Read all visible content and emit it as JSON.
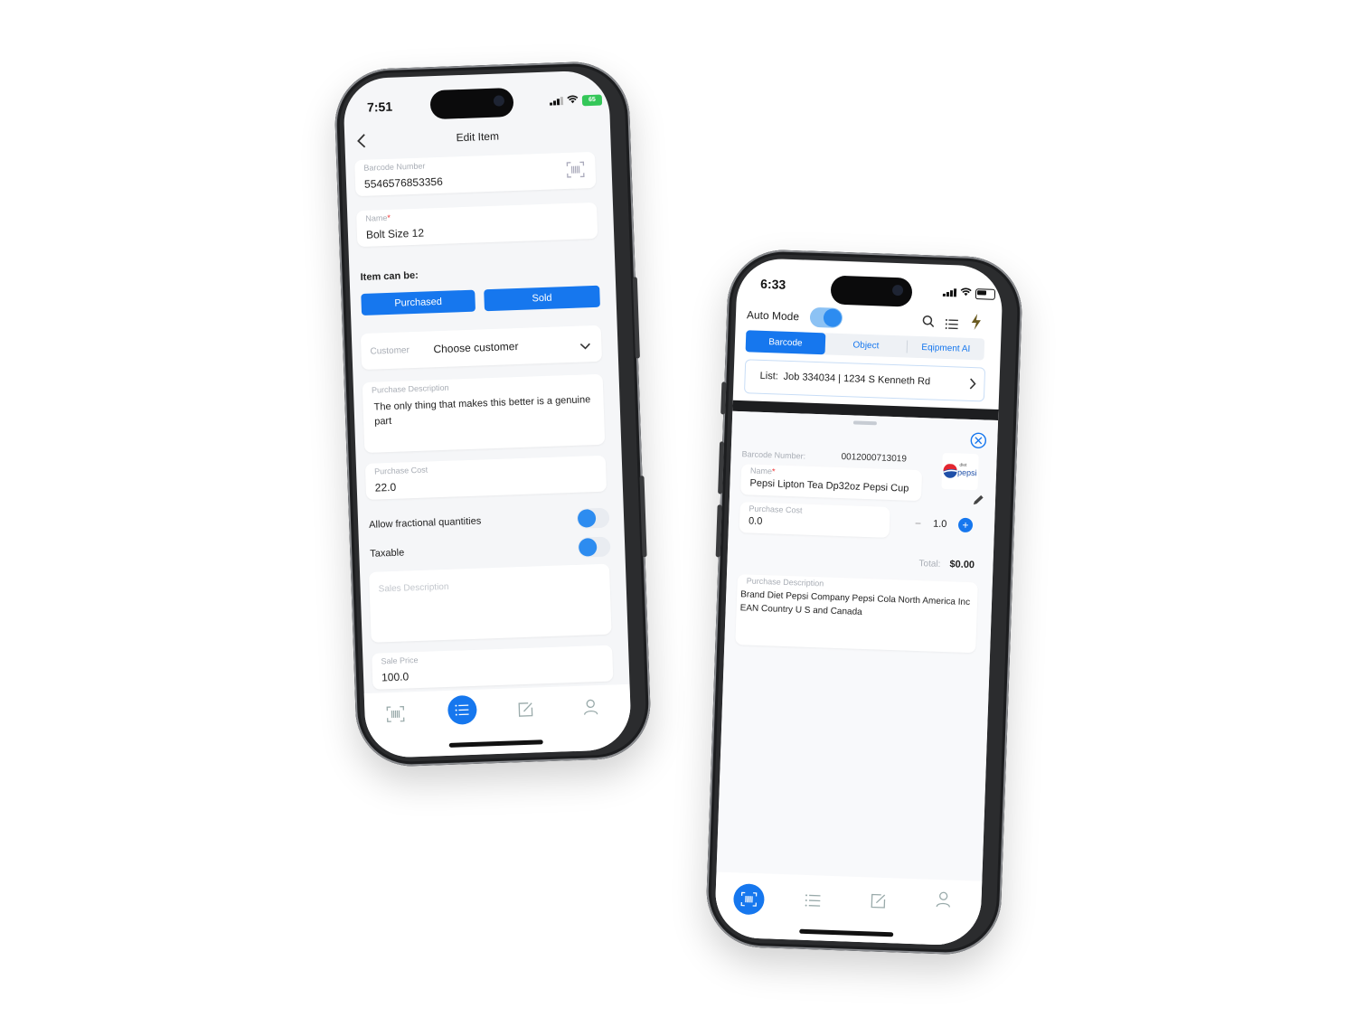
{
  "left_phone": {
    "status": {
      "time": "7:51",
      "battery": "65"
    },
    "header": {
      "title": "Edit Item"
    },
    "barcode": {
      "label": "Barcode Number",
      "value": "5546576853356"
    },
    "name": {
      "label": "Name",
      "value": "Bolt Size 12"
    },
    "item_can_be": {
      "label": "Item can be:",
      "purchased": "Purchased",
      "sold": "Sold"
    },
    "customer": {
      "label": "Customer",
      "value": "Choose customer"
    },
    "purchase_description": {
      "label": "Purchase Description",
      "value": "The only thing that makes this better is a genuine part"
    },
    "purchase_cost": {
      "label": "Purchase Cost",
      "value": "22.0"
    },
    "allow_fractional": {
      "label": "Allow fractional quantities"
    },
    "taxable": {
      "label": "Taxable"
    },
    "sales_description": {
      "placeholder": "Sales Description"
    },
    "sale_price": {
      "label": "Sale Price",
      "value": "100.0"
    },
    "nav": [
      "barcode-icon",
      "list-icon",
      "edit-icon",
      "person-icon"
    ],
    "accent": "#1677ee"
  },
  "right_phone": {
    "status": {
      "time": "6:33"
    },
    "auto_mode": {
      "label": "Auto Mode"
    },
    "tabs": [
      "Barcode",
      "Object",
      "Eqipment AI"
    ],
    "list": {
      "prefix": "List:",
      "value": "Job 334034 | 1234 S Kenneth Rd"
    },
    "barcode": {
      "label": "Barcode Number:",
      "value": "0012000713019"
    },
    "name": {
      "label": "Name",
      "value": "Pepsi Lipton Tea Dp32oz Pepsi Cup"
    },
    "purchase_cost": {
      "label": "Purchase Cost",
      "value": "0.0"
    },
    "quantity": {
      "minus": "−",
      "value": "1.0",
      "plus": "+"
    },
    "total": {
      "label": "Total:",
      "value": "$0.00"
    },
    "purchase_description": {
      "label": "Purchase Description",
      "value": "Brand Diet Pepsi Company Pepsi Cola North America Inc EAN Country U S and Canada"
    },
    "logo": {
      "small": "diet",
      "brand": "pepsi"
    },
    "nav": [
      "barcode-icon",
      "list-icon",
      "edit-icon",
      "person-icon"
    ],
    "accent": "#1677ee"
  }
}
